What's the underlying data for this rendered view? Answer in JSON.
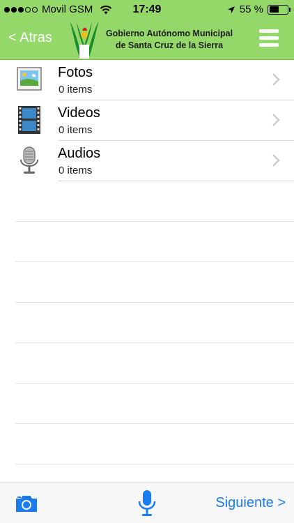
{
  "status_bar": {
    "carrier": "Movil GSM",
    "time": "17:49",
    "battery": "55 %",
    "battery_level": 0.55,
    "signal_dots_filled": 3,
    "signal_dots_total": 5
  },
  "nav": {
    "back_label": "< Atras",
    "brand_line1": "Gobierno Autónomo Municipal",
    "brand_line2": "de Santa Cruz de la Sierra"
  },
  "items": [
    {
      "title": "Fotos",
      "count": "0 items",
      "icon": "photo-icon"
    },
    {
      "title": "Videos",
      "count": "0 items",
      "icon": "film-icon"
    },
    {
      "title": "Audios",
      "count": "0 items",
      "icon": "microphone-icon"
    }
  ],
  "toolbar": {
    "next_label": "Siguiente >",
    "camera_icon": "camera-icon",
    "mic_icon": "microphone-icon"
  },
  "colors": {
    "header_green": "#95d86a",
    "accent_blue": "#1a7cf0"
  }
}
